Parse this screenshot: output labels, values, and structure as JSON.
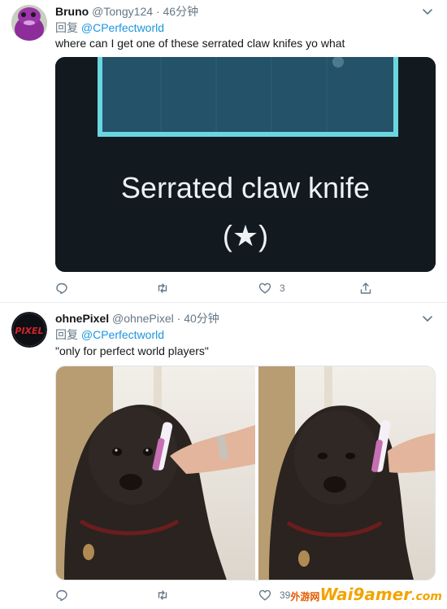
{
  "tweets": [
    {
      "author_name": "Bruno",
      "author_handle": "@Tongy124",
      "separator": "·",
      "time": "46分钟",
      "reply_prefix": "回复",
      "reply_to": "@CPerfectworld",
      "text": "where can I get one of these serrated claw knifes yo what",
      "media": {
        "title": "Serrated claw knife",
        "subtitle": "(★)"
      },
      "actions": {
        "reply_count": "",
        "retweet_count": "",
        "like_count": "3"
      }
    },
    {
      "author_name": "ohnePixel",
      "author_handle": "@ohnePixel",
      "separator": "·",
      "time": "40分钟",
      "reply_prefix": "回复",
      "reply_to": "@CPerfectworld",
      "text": "\"only for perfect world players\"",
      "avatar_text": "PIXEL",
      "actions": {
        "reply_count": "",
        "retweet_count": "",
        "like_count": "39"
      }
    }
  ],
  "watermark": {
    "brand": "Wai9amer",
    "suffix": ".com",
    "cn": "外游网"
  },
  "colors": {
    "text": "#14171a",
    "secondary": "#657786",
    "link": "#1b95e0",
    "divider": "#e6ecf0",
    "knife_card_bg": "#121a20",
    "knife_frame": "#6ad6e0"
  }
}
